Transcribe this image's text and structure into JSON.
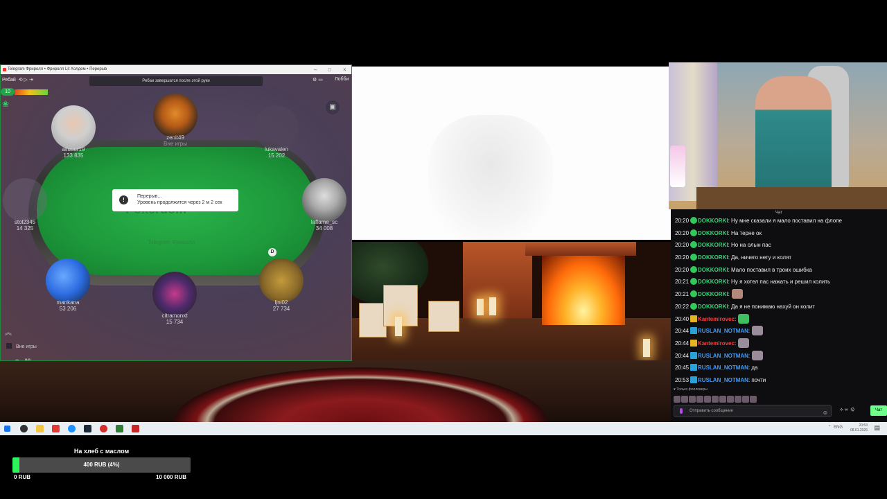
{
  "poker": {
    "window_title": "Telegram Фриролл • Фриролл Lit Холдем • Перерыв",
    "rebuy_label": "Ребай",
    "notice": "Ребаи завершатся после этой руки",
    "lobby_label": "Лобби",
    "level": "10",
    "felt_logo": "Pokerdom",
    "felt_text": "Telegram Фриролл",
    "dealer": "D",
    "break_title": "Перерыв...",
    "break_subtitle": "Уровень продолжится через 2 м 2 сек",
    "out_of_game": "Вне игры",
    "seats": [
      {
        "name": "aiiuuur19",
        "stack": "133 835"
      },
      {
        "name": "zenit49",
        "stack": "Вне игры"
      },
      {
        "name": "lukavalen",
        "stack": "15 202"
      },
      {
        "name": "stol2345",
        "stack": "14 325"
      },
      {
        "name": "laflame_sc",
        "stack": "34 008"
      },
      {
        "name": "mankana",
        "stack": "53 206"
      },
      {
        "name": "citramonxt",
        "stack": "15 734"
      },
      {
        "name": "ljni02",
        "stack": "27 734"
      }
    ]
  },
  "chat": {
    "title": "Чат",
    "messages": [
      {
        "time": "20:20",
        "user": "DOKKORKI",
        "text": ": Ну мне сказали я мало поставил на флопе",
        "color": "green",
        "badge": "check"
      },
      {
        "time": "20:20",
        "user": "DOKKORKI",
        "text": ": На терне ок",
        "color": "green",
        "badge": "check"
      },
      {
        "time": "20:20",
        "user": "DOKKORKI",
        "text": ": Но на олын пас",
        "color": "green",
        "badge": "check"
      },
      {
        "time": "20:20",
        "user": "DOKKORKI",
        "text": ": Да, ничего нету и колят",
        "color": "green",
        "badge": "check"
      },
      {
        "time": "20:20",
        "user": "DOKKORKI",
        "text": ": Мало поставил в троих ошибка",
        "color": "green",
        "badge": "check"
      },
      {
        "time": "20:21",
        "user": "DOKKORKI",
        "text": ": Ну я хотел пас нажать и решил колить",
        "color": "green",
        "badge": "check"
      },
      {
        "time": "20:21",
        "user": "DOKKORKI",
        "text": ":",
        "color": "green",
        "badge": "check",
        "emote": "face"
      },
      {
        "time": "20:22",
        "user": "DOKKORKI",
        "text": ": Да я не понимаю нахуй он колит",
        "color": "green",
        "badge": "check"
      },
      {
        "time": "20:40",
        "user": "Kantemirovec",
        "text": ":",
        "color": "red",
        "badge": "crown",
        "emote": "frog"
      },
      {
        "time": "20:44",
        "user": "RUSLAN_NOTMAN",
        "text": ":",
        "color": "blue",
        "badge": "tag",
        "emote": "gray"
      },
      {
        "time": "20:44",
        "user": "Kantemirovec",
        "text": ":",
        "color": "red",
        "badge": "crown",
        "emote": "gray"
      },
      {
        "time": "20:44",
        "user": "RUSLAN_NOTMAN",
        "text": ":",
        "color": "blue",
        "badge": "tag",
        "emote": "gray"
      },
      {
        "time": "20:45",
        "user": "RUSLAN_NOTMAN",
        "text": ": да",
        "color": "blue",
        "badge": "tag"
      },
      {
        "time": "20:53",
        "user": "RUSLAN_NOTMAN",
        "text": ": почти",
        "color": "blue",
        "badge": "tag"
      }
    ],
    "followers_only": "Только фолловеры",
    "input_placeholder": "Отправить сообщение",
    "points": "∞",
    "send_label": "Чат"
  },
  "taskbar": {
    "lang": "ENG",
    "time": "20:53",
    "date": "08.01.2026"
  },
  "goal": {
    "title": "На хлеб с маслом",
    "current": "400 RUB (4%)",
    "progress_percent": 4,
    "min": "0 RUB",
    "max": "10 000 RUB"
  }
}
